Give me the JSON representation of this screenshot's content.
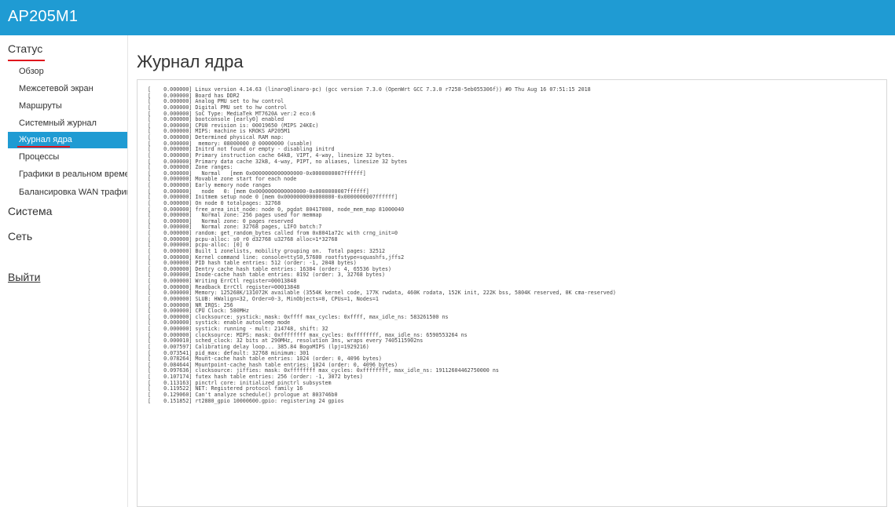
{
  "header": {
    "brand": "AP205M1"
  },
  "sidebar": {
    "status": {
      "label": "Статус",
      "items": [
        {
          "label": "Обзор",
          "active": false
        },
        {
          "label": "Межсетевой экран",
          "active": false
        },
        {
          "label": "Маршруты",
          "active": false
        },
        {
          "label": "Системный журнал",
          "active": false
        },
        {
          "label": "Журнал ядра",
          "active": true
        },
        {
          "label": "Процессы",
          "active": false
        },
        {
          "label": "Графики в реальном време",
          "active": false
        },
        {
          "label": "Балансировка WAN трафик",
          "active": false
        }
      ]
    },
    "system_label": "Система",
    "network_label": "Сеть",
    "logout_label": "Выйти"
  },
  "main": {
    "title": "Журнал ядра",
    "log": [
      "[    0.000000] Linux version 4.14.63 (linaro@linaro-pc) (gcc version 7.3.0 (OpenWrt GCC 7.3.0 r7258-5eb055306f)) #0 Thu Aug 16 07:51:15 2018",
      "[    0.000000] Board has DDR2",
      "[    0.000000] Analog PMU set to hw control",
      "[    0.000000] Digital PMU set to hw control",
      "[    0.000000] SoC Type: MediaTek MT7620A ver:2 eco:6",
      "[    0.000000] bootconsole [early0] enabled",
      "[    0.000000] CPU0 revision is: 00019650 (MIPS 24KEc)",
      "[    0.000000] MIPS: machine is KROKS AP205M1",
      "[    0.000000] Determined physical RAM map:",
      "[    0.000000]  memory: 08000000 @ 00000000 (usable)",
      "[    0.000000] Initrd not found or empty - disabling initrd",
      "[    0.000000] Primary instruction cache 64kB, VIPT, 4-way, linesize 32 bytes.",
      "[    0.000000] Primary data cache 32kB, 4-way, PIPT, no aliases, linesize 32 bytes",
      "[    0.000000] Zone ranges:",
      "[    0.000000]   Normal   [mem 0x0000000000000000-0x0000000007ffffff]",
      "[    0.000000] Movable zone start for each node",
      "[    0.000000] Early memory node ranges",
      "[    0.000000]   node   0: [mem 0x0000000000000000-0x0000000007ffffff]",
      "[    0.000000] Initmem setup node 0 [mem 0x0000000000000000-0x0000000007ffffff]",
      "[    0.000000] On node 0 totalpages: 32768",
      "[    0.000000] free_area_init_node: node 0, pgdat 80417000, node_mem_map 81000040",
      "[    0.000000]   Normal zone: 256 pages used for memmap",
      "[    0.000000]   Normal zone: 0 pages reserved",
      "[    0.000000]   Normal zone: 32768 pages, LIFO batch:7",
      "[    0.000000] random: get_random_bytes called from 0x8041a72c with crng_init=0",
      "[    0.000000] pcpu-alloc: s0 r0 d32768 u32768 alloc=1*32768",
      "[    0.000000] pcpu-alloc: [0] 0",
      "[    0.000000] Built 1 zonelists, mobility grouping on.  Total pages: 32512",
      "[    0.000000] Kernel command line: console=ttyS0,57600 rootfstype=squashfs,jffs2",
      "[    0.000000] PID hash table entries: 512 (order: -1, 2048 bytes)",
      "[    0.000000] Dentry cache hash table entries: 16384 (order: 4, 65536 bytes)",
      "[    0.000000] Inode-cache hash table entries: 8192 (order: 3, 32768 bytes)",
      "[    0.000000] Writing ErrCtl register=00013848",
      "[    0.000000] Readback ErrCtl register=00013848",
      "[    0.000000] Memory: 125268K/131072K available (3554K kernel code, 177K rwdata, 460K rodata, 152K init, 222K bss, 5804K reserved, 0K cma-reserved)",
      "[    0.000000] SLUB: HWalign=32, Order=0-3, MinObjects=0, CPUs=1, Nodes=1",
      "[    0.000000] NR_IRQS: 256",
      "[    0.000000] CPU Clock: 580MHz",
      "[    0.000000] clocksource: systick: mask: 0xffff max_cycles: 0xffff, max_idle_ns: 583261500 ns",
      "[    0.000000] systick: enable autosleep mode",
      "[    0.000000] systick: running - mult: 214748, shift: 32",
      "[    0.000000] clocksource: MIPS: mask: 0xffffffff max_cycles: 0xffffffff, max_idle_ns: 6590553264 ns",
      "[    0.000010] sched_clock: 32 bits at 290MHz, resolution 3ns, wraps every 7405115902ns",
      "[    0.007597] Calibrating delay loop... 385.84 BogoMIPS (lpj=1929216)",
      "[    0.073541] pid_max: default: 32768 minimum: 301",
      "[    0.078264] Mount-cache hash table entries: 1024 (order: 0, 4096 bytes)",
      "[    0.084644] Mountpoint-cache hash table entries: 1024 (order: 0, 4096 bytes)",
      "[    0.097636] clocksource: jiffies: mask: 0xffffffff max_cycles: 0xffffffff, max_idle_ns: 19112604462750000 ns",
      "[    0.107174] futex hash table entries: 256 (order: -1, 3072 bytes)",
      "[    0.113163] pinctrl core: initialized pinctrl subsystem",
      "[    0.119522] NET: Registered protocol family 16",
      "[    0.129060] Can't analyze schedule() prologue at 803746b0",
      "[    0.151852] rt2880_gpio 10000600.gpio: registering 24 gpios"
    ]
  },
  "colors": {
    "accent": "#1f9bd3",
    "underline": "#e0141c"
  }
}
